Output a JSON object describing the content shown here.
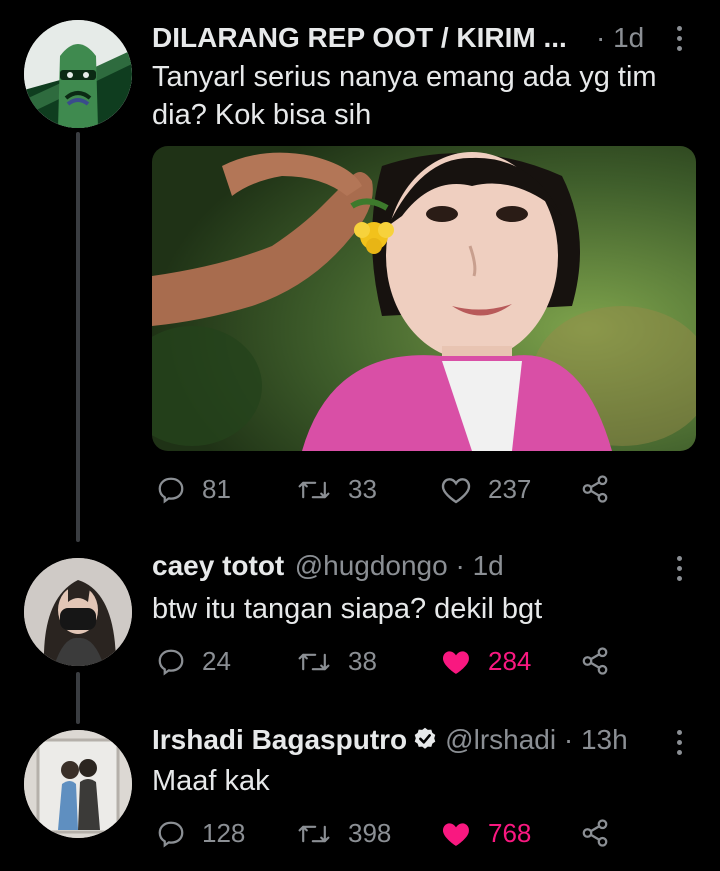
{
  "tweet1": {
    "name": "DILARANG REP OOT / KIRIM ...",
    "time": "· 1d",
    "text_line1": "Tanyarl serius nanya emang ada yg tim",
    "text_line2": "dia? Kok bisa sih",
    "replies": "81",
    "retweets": "33",
    "likes": "237",
    "liked": false
  },
  "tweet2": {
    "name": "caey totot",
    "handle_time": "@hugdongo · 1d",
    "text": "btw itu tangan siapa? dekil bgt",
    "replies": "24",
    "retweets": "38",
    "likes": "284",
    "liked": true
  },
  "tweet3": {
    "name": "Irshadi Bagasputro",
    "handle_time": "@lrshadi · 13h",
    "text": "Maaf kak",
    "replies": "128",
    "retweets": "398",
    "likes": "768",
    "liked": true
  },
  "colors": {
    "background": "#000000",
    "text": "#e7e9ea",
    "muted": "#8b8f94",
    "like": "#f91880"
  },
  "icons": [
    "reply-icon",
    "retweet-icon",
    "like-icon",
    "share-icon",
    "more-icon",
    "verified-icon"
  ]
}
